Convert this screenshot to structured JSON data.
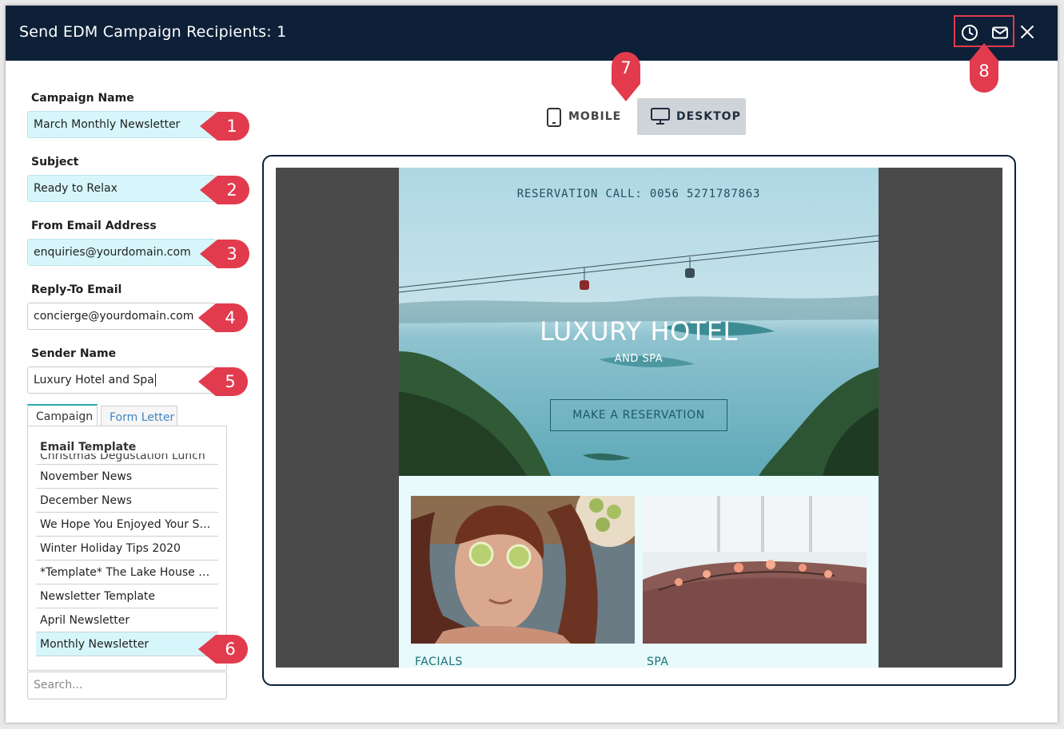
{
  "dialog": {
    "title": "Send EDM Campaign Recipients: 1",
    "header_icons": [
      "clock-icon",
      "envelope-icon",
      "close-icon"
    ]
  },
  "form": {
    "campaign_name": {
      "label": "Campaign Name",
      "value": "March Monthly Newsletter"
    },
    "subject": {
      "label": "Subject",
      "value": "Ready to Relax"
    },
    "from_email": {
      "label": "From Email Address",
      "value": "enquiries@yourdomain.com"
    },
    "reply_to": {
      "label": "Reply-To Email",
      "value": "concierge@yourdomain.com"
    },
    "sender_name": {
      "label": "Sender Name",
      "value": "Luxury Hotel and Spa"
    }
  },
  "tabs": [
    {
      "label": "Campaign",
      "active": true
    },
    {
      "label": "Form Letter",
      "active": false
    }
  ],
  "templates": {
    "heading": "Email Template",
    "items": [
      "Christmas Degustation Lunch",
      "November News",
      "December News",
      "We Hope You Enjoyed Your Stay!",
      "Winter Holiday Tips 2020",
      "*Template* The Lake House Ne...",
      "Newsletter Template",
      "April Newsletter",
      "Monthly Newsletter"
    ],
    "selected": "Monthly Newsletter",
    "search_placeholder": "Search..."
  },
  "view_toggle": {
    "mobile_label": "MOBILE",
    "desktop_label": "DESKTOP",
    "active": "desktop"
  },
  "email_preview": {
    "reservation_line": "RESERVATION CALL: 0056 5271787863",
    "brand_title": "LUXURY HOTEL",
    "brand_subtitle": "AND SPA",
    "cta_label": "MAKE A RESERVATION",
    "card_1_label": "FACIALS",
    "card_2_label": "SPA"
  },
  "callouts": [
    "1",
    "2",
    "3",
    "4",
    "5",
    "6",
    "7",
    "8"
  ],
  "colors": {
    "header_bg": "#0d2038",
    "highlight_field": "#d6f6fb",
    "callout": "#e23b4e",
    "desktop_button": "#cfd4d9",
    "email_bg": "#e8fafb",
    "accent_text": "#1c6f78"
  }
}
